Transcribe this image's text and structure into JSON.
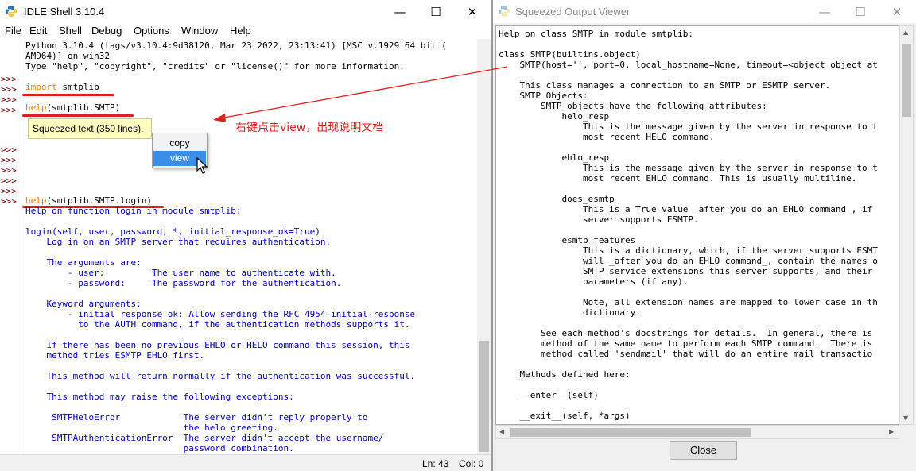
{
  "idle_window": {
    "title": "IDLE Shell 3.10.4",
    "controls": {
      "minimize": "—",
      "maximize": "☐",
      "close": "✕"
    },
    "menu": [
      "File",
      "Edit",
      "Shell",
      "Debug",
      "Options",
      "Window",
      "Help"
    ],
    "prompt_symbol": ">>>",
    "banner": [
      "Python 3.10.4 (tags/v3.10.4:9d38120, Mar 23 2022, 23:13:41) [MSC v.1929 64 bit (",
      "AMD64)] on win32",
      "Type \"help\", \"copyright\", \"credits\" or \"license()\" for more information."
    ],
    "cmd1": {
      "keyword": "import",
      "rest": " smtplib"
    },
    "cmd2": {
      "func": "help",
      "rest": "(smtplib.SMTP)"
    },
    "squeezed_label": "Squeezed text (350 lines).",
    "context_menu": {
      "copy": "copy",
      "view": "view"
    },
    "cmd3": {
      "func": "help",
      "rest": "(smtplib.SMTP.login)"
    },
    "output": [
      "Help on function login in module smtplib:",
      "",
      "login(self, user, password, *, initial_response_ok=True)",
      "    Log in on an SMTP server that requires authentication.",
      "",
      "    The arguments are:",
      "        - user:         The user name to authenticate with.",
      "        - password:     The password for the authentication.",
      "",
      "    Keyword arguments:",
      "        - initial_response_ok: Allow sending the RFC 4954 initial-response",
      "          to the AUTH command, if the authentication methods supports it.",
      "",
      "    If there has been no previous EHLO or HELO command this session, this",
      "    method tries ESMTP EHLO first.",
      "",
      "    This method will return normally if the authentication was successful.",
      "",
      "    This method may raise the following exceptions:",
      "",
      "     SMTPHeloError            The server didn't reply properly to",
      "                              the helo greeting.",
      "     SMTPAuthenticationError  The server didn't accept the username/",
      "                              password combination."
    ],
    "status": {
      "line": "Ln: 43",
      "col": "Col: 0"
    }
  },
  "annotation": {
    "text": "右键点击view，出现说明文档",
    "color": "#e31c1c"
  },
  "viewer_window": {
    "title": "Squeezed Output Viewer",
    "controls": {
      "minimize": "—",
      "maximize": "☐",
      "close": "✕"
    },
    "lines": [
      "Help on class SMTP in module smtplib:",
      "",
      "class SMTP(builtins.object)",
      "    SMTP(host='', port=0, local_hostname=None, timeout=<object object at",
      "",
      "    This class manages a connection to an SMTP or ESMTP server.",
      "    SMTP Objects:",
      "        SMTP objects have the following attributes:",
      "            helo_resp",
      "                This is the message given by the server in response to t",
      "                most recent HELO command.",
      "",
      "            ehlo_resp",
      "                This is the message given by the server in response to t",
      "                most recent EHLO command. This is usually multiline.",
      "",
      "            does_esmtp",
      "                This is a True value _after you do an EHLO command_, if",
      "                server supports ESMTP.",
      "",
      "            esmtp_features",
      "                This is a dictionary, which, if the server supports ESMT",
      "                will _after you do an EHLO command_, contain the names o",
      "                SMTP service extensions this server supports, and their",
      "                parameters (if any).",
      "",
      "                Note, all extension names are mapped to lower case in th",
      "                dictionary.",
      "",
      "        See each method's docstrings for details.  In general, there is",
      "        method of the same name to perform each SMTP command.  There is",
      "        method called 'sendmail' that will do an entire mail transactio",
      "",
      "    Methods defined here:",
      "",
      "    __enter__(self)",
      "",
      "    __exit__(self, *args)"
    ],
    "close_label": "Close"
  },
  "colors": {
    "prompt": "#770000",
    "keyword": "#ff7700",
    "output_text": "#0000c0",
    "annotation_red": "#e31c1c",
    "menu_highlight": "#3b8ee8",
    "squeezed_bg": "#ffffc0"
  }
}
